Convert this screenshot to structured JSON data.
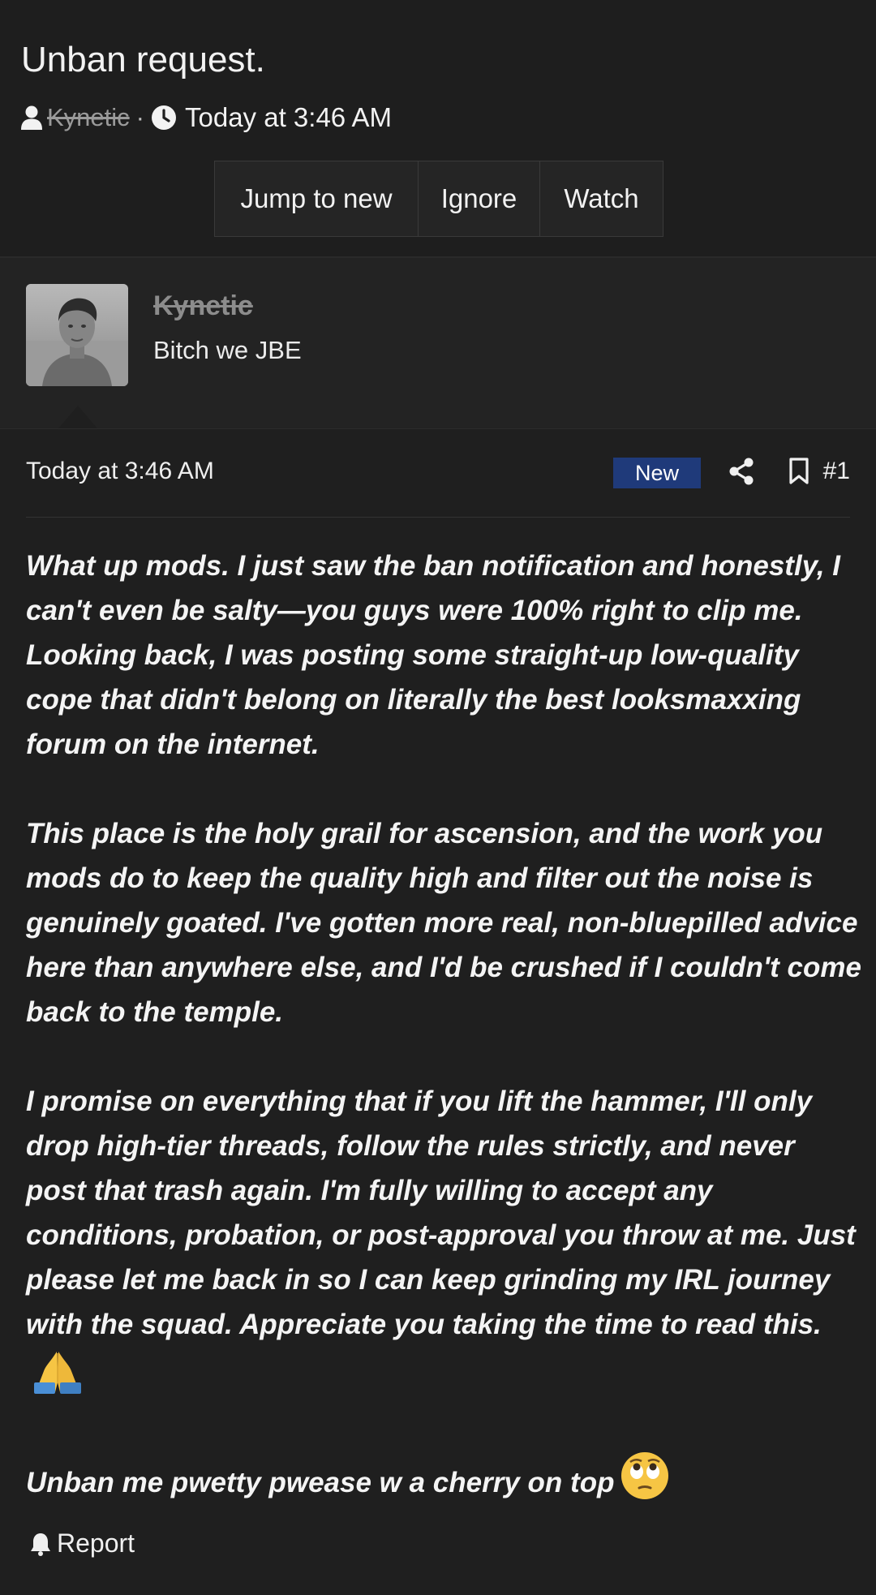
{
  "thread": {
    "title": "Unban request.",
    "author": "Kynetic",
    "separator": "·",
    "time": "Today at 3:46 AM",
    "buttons": {
      "jump_to_new": "Jump to new",
      "ignore": "Ignore",
      "watch": "Watch"
    }
  },
  "user": {
    "name": "Kynetic",
    "title": "Bitch we JBE"
  },
  "post": {
    "date": "Today at 3:46 AM",
    "badge": "New",
    "number": "#1",
    "paragraphs": {
      "p1": "What up mods. I just saw the ban notification and honestly, I can't even be salty—you guys were 100% right to clip me. Looking back, I was posting some straight-up low-quality cope that didn't belong on literally the best looksmaxxing forum on the internet.",
      "p2": "This place is the holy grail for ascension, and the work you mods do to keep the quality high and filter out the noise is genuinely goated. I've gotten more real, non-bluepilled advice here than anywhere else, and I'd be crushed if I couldn't come back to the temple.",
      "p3": "I promise on everything that if you lift the hammer, I'll only drop high-tier threads, follow the rules strictly, and never post that trash again. I'm fully willing to accept any conditions, probation, or post-approval you throw at me. Just please let me back in so I can keep grinding my IRL journey with the squad. Appreciate you taking the time to read this.",
      "p4": "Unban me pwetty pwease w a cherry on top"
    },
    "emojis": {
      "p3_end": "folded-hands-emoji",
      "p4_end": "face-with-rolling-eyes-emoji"
    }
  },
  "footer": {
    "report": "Report"
  },
  "icons": {
    "user": "user-icon",
    "clock": "clock-icon",
    "share": "share-icon",
    "bookmark": "bookmark-icon",
    "bell": "bell-icon"
  },
  "colors": {
    "background": "#1f1f1f",
    "badge": "#1f3a7a",
    "muted_username": "#8c8c8c"
  }
}
